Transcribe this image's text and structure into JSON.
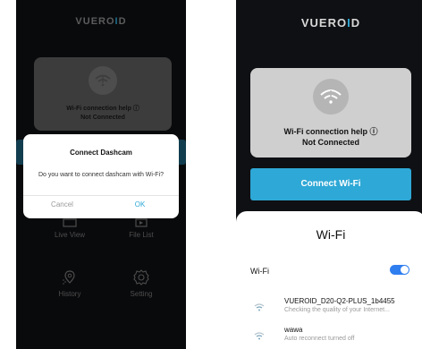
{
  "brand": {
    "logo_left": "VUERO",
    "logo_bar": "I",
    "logo_right": "D",
    "accent": "#2ea8d6"
  },
  "left_screen": {
    "help_title": "Wi-Fi connection help ⓘ",
    "status": "Not Connected",
    "menu": [
      {
        "label": "Live View",
        "icon": "live-view-icon"
      },
      {
        "label": "File List",
        "icon": "file-list-icon"
      },
      {
        "label": "History",
        "icon": "history-icon"
      },
      {
        "label": "Setting",
        "icon": "setting-icon"
      }
    ],
    "dialog": {
      "title": "Connect Dashcam",
      "message": "Do you want to connect dashcam with Wi-Fi?",
      "cancel": "Cancel",
      "ok": "OK"
    }
  },
  "right_screen": {
    "help_title": "Wi-Fi connection help ⓘ",
    "status": "Not Connected",
    "connect_button": "Connect Wi-Fi",
    "sheet": {
      "title": "Wi-Fi",
      "wifi_label": "Wi-Fi",
      "wifi_enabled": true,
      "networks": [
        {
          "name": "VUEROID_D20-Q2-PLUS_1b4455",
          "status": "Checking the quality of your Internet..."
        },
        {
          "name": "wawa",
          "status": "Auto reconnect turned off"
        }
      ]
    }
  }
}
